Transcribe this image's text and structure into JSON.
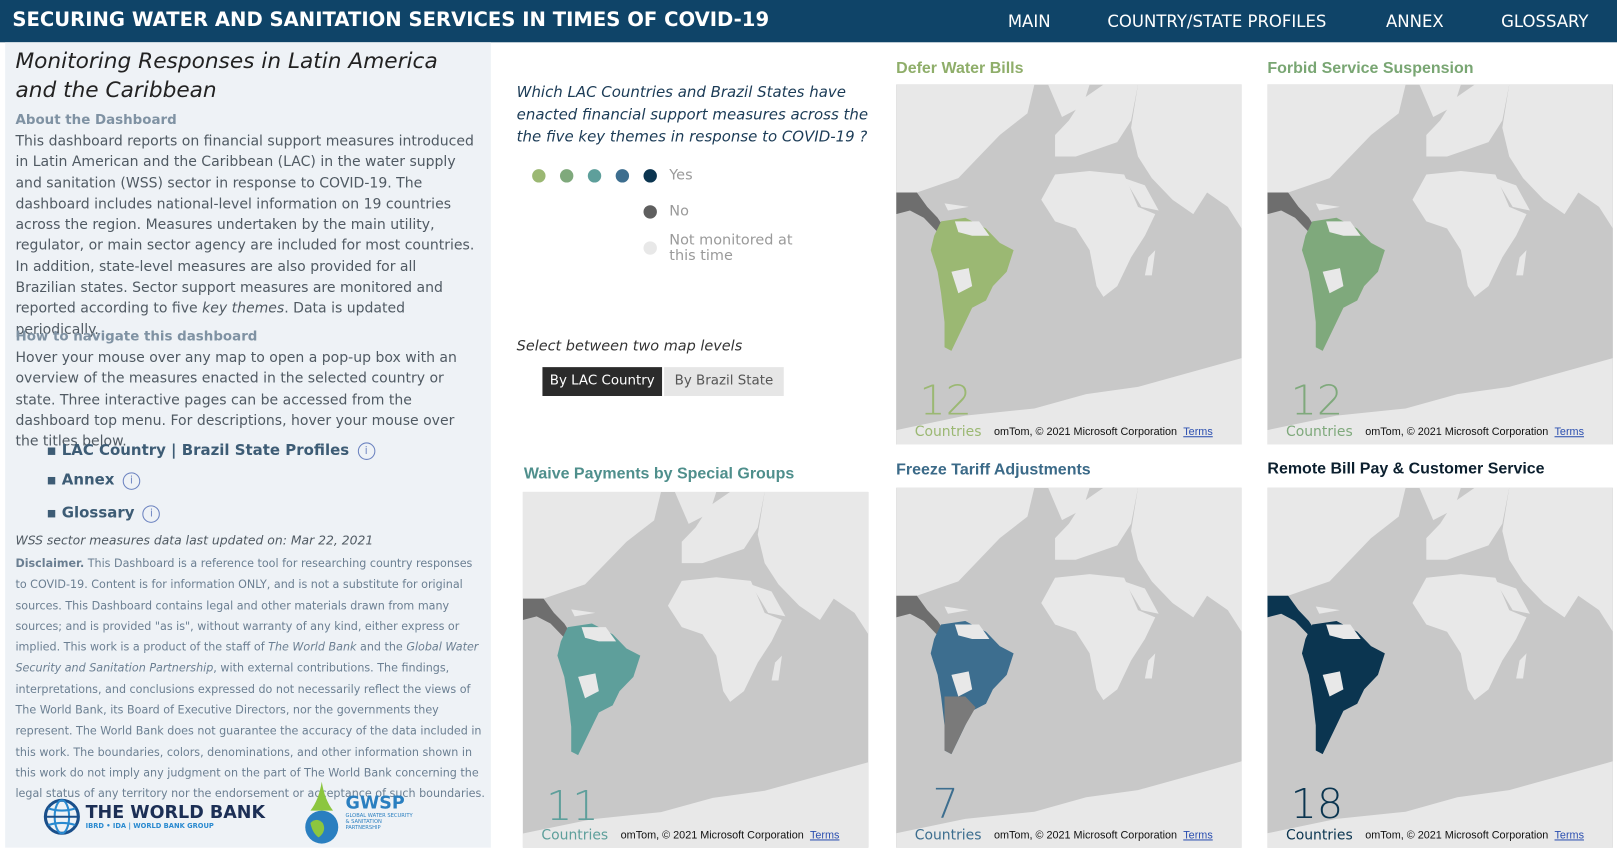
{
  "header": {
    "title": "SECURING WATER AND SANITATION SERVICES IN TIMES OF COVID-19",
    "nav": [
      "MAIN",
      "COUNTRY/STATE PROFILES",
      "ANNEX",
      "GLOSSARY"
    ]
  },
  "left": {
    "title": "Monitoring Responses in Latin America and the Caribbean",
    "about_heading": "About the Dashboard",
    "about_text_1": "This dashboard reports on financial support measures introduced in Latin American and the Caribbean (LAC) in the water supply and sanitation (WSS) sector in response to COVID-19.  The dashboard includes national-level information on 19 countries across the region.  Measures undertaken by the main utility, regulator, or main sector agency are included for most countries.  In addition, state-level measures are also provided for all Brazilian states.  Sector support measures are monitored and reported according to five ",
    "about_text_em": "key themes",
    "about_text_2": ". Data is updated periodically.",
    "nav_heading": "How to navigate this dashboard",
    "nav_text": "Hover your mouse over any map to open a pop-up box with an overview of the measures enacted in the selected country or state.  Three interactive pages can be accessed from the dashboard top menu.  For descriptions, hover your mouse over the titles below.",
    "links": [
      "LAC Country | Brazil State Profiles",
      "Annex",
      "Glossary"
    ],
    "updated": "WSS sector measures data last updated on: Mar 22, 2021",
    "disclaimer_label": "Disclaimer.",
    "disclaimer_1": " This Dashboard is a reference tool for researching country responses  to COVID-19. Content is for information ONLY, and is not a substitute for original sources. This Dashboard contains legal and other materials drawn from many sources; and is provided \"as is\", without warranty of any kind, either express or implied. This work is a product of the staff of ",
    "disclaimer_wb": "The World Bank",
    "disclaimer_2": " and the ",
    "disclaimer_gwsp": "Global Water Security and Sanitation Partnership",
    "disclaimer_3": ", with external contributions. The findings, interpretations, and conclusions expressed do not necessarily reflect the views of The World Bank, its Board of Executive Directors, nor the governments they represent. The World Bank does not guarantee the accuracy of the data included in this work. The boundaries, colors, denominations, and other information shown in this work do not imply any judgment on the part of The World Bank concerning the legal status of any territory nor the endorsement or acceptance of such boundaries.",
    "logo_wb": "THE WORLD BANK",
    "logo_wb_sub": "IBRD • IDA | WORLD BANK GROUP",
    "logo_gwsp": "GWSP",
    "logo_gwsp_sub": "GLOBAL WATER SECURITY & SANITATION PARTNERSHIP"
  },
  "middle": {
    "question": "Which LAC Countries and Brazil States have enacted financial support measures across the the five key themes in response to COVID-19 ?",
    "legend": {
      "yes": "Yes",
      "no": "No",
      "not_monitored": "Not monitored at this time",
      "yes_colors": [
        "#9bb873",
        "#7fa97c",
        "#5e9f9b",
        "#3d6e8f",
        "#0b3550"
      ],
      "no_color": "#5f5f5f",
      "nm_color": "#e8e8e8"
    },
    "select_label": "Select between two map levels",
    "buttons": [
      "By LAC Country",
      "By Brazil State"
    ],
    "active_button": 0
  },
  "maps": [
    {
      "title": "Defer Water Bills",
      "count": "12",
      "unit": "Countries",
      "color": "#9bb873",
      "title_color": "#8fae6a"
    },
    {
      "title": "Forbid Service Suspension",
      "count": "12",
      "unit": "Countries",
      "color": "#7fa97c",
      "title_color": "#79a673"
    },
    {
      "title": "Waive Payments by Special Groups",
      "count": "11",
      "unit": "Countries",
      "color": "#5e9f9b",
      "title_color": "#4f8f8c"
    },
    {
      "title": "Freeze Tariff Adjustments",
      "count": "7",
      "unit": "Countries",
      "color": "#3d6e8f",
      "title_color": "#3b6a88"
    },
    {
      "title": "Remote Bill Pay & Customer Service",
      "count": "18",
      "unit": "Countries",
      "color": "#0b3550",
      "title_color": "#0b1f2e"
    }
  ],
  "map_attribution": "omTom, © 2021 Microsoft Corporation",
  "map_terms": "Terms"
}
